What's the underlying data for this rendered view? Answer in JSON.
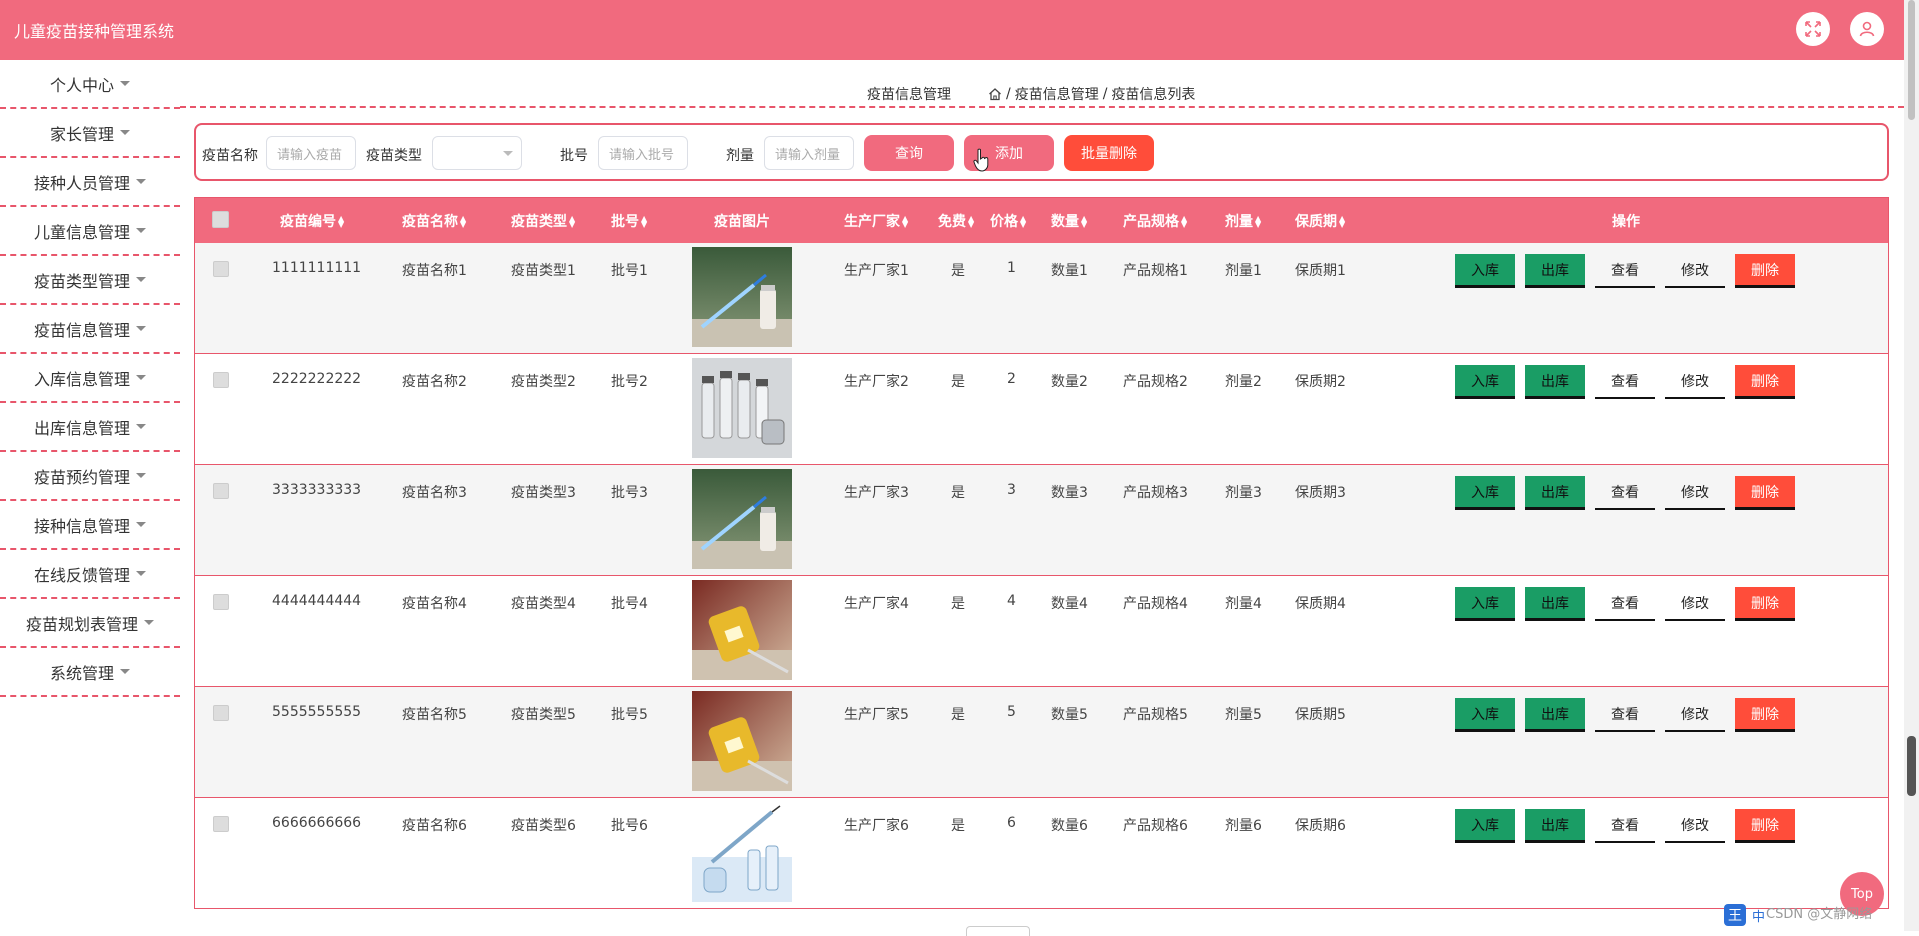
{
  "app": {
    "title": "儿童疫苗接种管理系统",
    "fullscreen_icon": "fullscreen-icon",
    "user_icon": "user-icon"
  },
  "sidebar": {
    "items": [
      {
        "label": "个人中心"
      },
      {
        "label": "家长管理"
      },
      {
        "label": "接种人员管理"
      },
      {
        "label": "儿童信息管理"
      },
      {
        "label": "疫苗类型管理"
      },
      {
        "label": "疫苗信息管理"
      },
      {
        "label": "入库信息管理"
      },
      {
        "label": "出库信息管理"
      },
      {
        "label": "疫苗预约管理"
      },
      {
        "label": "接种信息管理"
      },
      {
        "label": "在线反馈管理"
      },
      {
        "label": "疫苗规划表管理"
      },
      {
        "label": "系统管理"
      }
    ]
  },
  "breadcrumb": {
    "page_title": "疫苗信息管理",
    "home_icon": "home-icon",
    "path_1": "疫苗信息管理",
    "sep": "/",
    "path_2": "疫苗信息列表"
  },
  "search": {
    "name_label": "疫苗名称",
    "name_placeholder": "请输入疫苗",
    "type_label": "疫苗类型",
    "type_value": "",
    "batch_label": "批号",
    "batch_placeholder": "请输入批号",
    "dose_label": "剂量",
    "dose_placeholder": "请输入剂量",
    "query_btn": "查询",
    "add_btn": "添加",
    "batch_delete_btn": "批量删除"
  },
  "colors": {
    "accent": "#f16a7e",
    "green": "#1a9d65",
    "red": "#ff4d3a"
  },
  "table": {
    "headers": {
      "code": "疫苗编号",
      "name": "疫苗名称",
      "type": "疫苗类型",
      "batch": "批号",
      "image": "疫苗图片",
      "maker": "生产厂家",
      "free": "免费",
      "price": "价格",
      "qty": "数量",
      "spec": "产品规格",
      "dose": "剂量",
      "shelf": "保质期",
      "ops": "操作"
    },
    "ops": {
      "in": "入库",
      "out": "出库",
      "view": "查看",
      "edit": "修改",
      "del": "删除"
    },
    "rows": [
      {
        "code": "1111111111",
        "name": "疫苗名称1",
        "type": "疫苗类型1",
        "batch": "批号1",
        "image": "syringe-vial",
        "maker": "生产厂家1",
        "free": "是",
        "price": "1",
        "qty": "数量1",
        "spec": "产品规格1",
        "dose": "剂量1",
        "shelf": "保质期1"
      },
      {
        "code": "2222222222",
        "name": "疫苗名称2",
        "type": "疫苗类型2",
        "batch": "批号2",
        "image": "vials-row",
        "maker": "生产厂家2",
        "free": "是",
        "price": "2",
        "qty": "数量2",
        "spec": "产品规格2",
        "dose": "剂量2",
        "shelf": "保质期2"
      },
      {
        "code": "3333333333",
        "name": "疫苗名称3",
        "type": "疫苗类型3",
        "batch": "批号3",
        "image": "syringe-vial",
        "maker": "生产厂家3",
        "free": "是",
        "price": "3",
        "qty": "数量3",
        "spec": "产品规格3",
        "dose": "剂量3",
        "shelf": "保质期3"
      },
      {
        "code": "4444444444",
        "name": "疫苗名称4",
        "type": "疫苗类型4",
        "batch": "批号4",
        "image": "yellow-vial",
        "maker": "生产厂家4",
        "free": "是",
        "price": "4",
        "qty": "数量4",
        "spec": "产品规格4",
        "dose": "剂量4",
        "shelf": "保质期4"
      },
      {
        "code": "5555555555",
        "name": "疫苗名称5",
        "type": "疫苗类型5",
        "batch": "批号5",
        "image": "yellow-vial",
        "maker": "生产厂家5",
        "free": "是",
        "price": "5",
        "qty": "数量5",
        "spec": "产品规格5",
        "dose": "剂量5",
        "shelf": "保质期5"
      },
      {
        "code": "6666666666",
        "name": "疫苗名称6",
        "type": "疫苗类型6",
        "batch": "批号6",
        "image": "syringe-vials-blue",
        "maker": "生产厂家6",
        "free": "是",
        "price": "6",
        "qty": "数量6",
        "spec": "产品规格6",
        "dose": "剂量6",
        "shelf": "保质期6"
      }
    ]
  },
  "top_button": "Top",
  "ime": {
    "wang": "王",
    "zh": "中"
  },
  "watermark": "CSDN @文静网络"
}
